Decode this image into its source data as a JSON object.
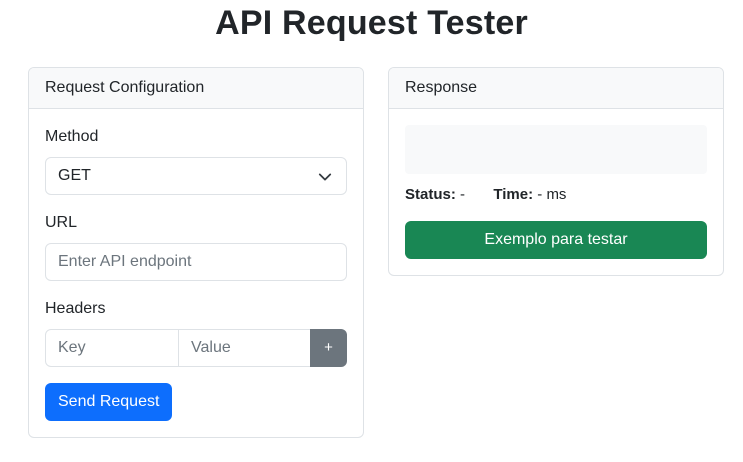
{
  "page": {
    "title": "API Request Tester"
  },
  "request_card": {
    "header": "Request Configuration",
    "method_label": "Method",
    "method_value": "GET",
    "url_label": "URL",
    "url_placeholder": "Enter API endpoint",
    "headers_label": "Headers",
    "header_key_placeholder": "Key",
    "header_value_placeholder": "Value",
    "add_header_label": "+",
    "send_label": "Send Request"
  },
  "response_card": {
    "header": "Response",
    "body": "",
    "status_label": "Status:",
    "status_value": "-",
    "time_label": "Time:",
    "time_value": "-",
    "time_unit": "ms",
    "example_label": "Exemplo para testar"
  },
  "colors": {
    "primary": "#0d6efd",
    "success": "#198754",
    "secondary": "#6c757d"
  },
  "icons": {
    "select_arrow": "chevron-down-icon"
  }
}
